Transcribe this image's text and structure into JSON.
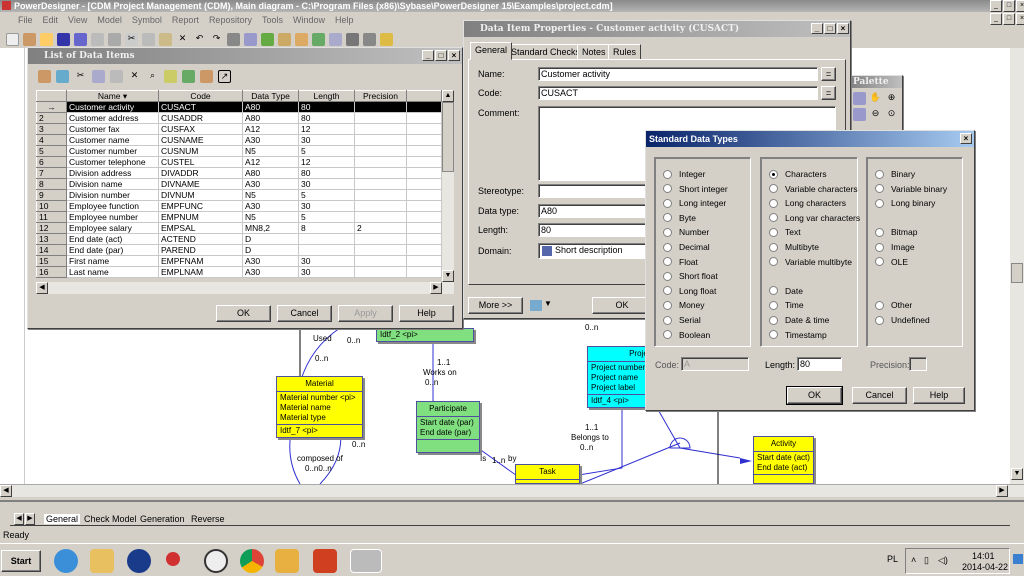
{
  "app": {
    "title": "PowerDesigner - [CDM Project Management (CDM), Main diagram - C:\\Program Files (x86)\\Sybase\\PowerDesigner 15\\Examples\\project.cdm]",
    "menu": [
      "File",
      "Edit",
      "View",
      "Model",
      "Symbol",
      "Report",
      "Repository",
      "Tools",
      "Window",
      "Help"
    ],
    "status": "Ready"
  },
  "list_window": {
    "title": "List of Data Items",
    "columns": [
      "Name",
      "Code",
      "Data Type",
      "Length",
      "Precision"
    ],
    "rows": [
      [
        "→",
        "Customer activity",
        "CUSACT",
        "A80",
        "80",
        ""
      ],
      [
        "2",
        "Customer address",
        "CUSADDR",
        "A80",
        "80",
        ""
      ],
      [
        "3",
        "Customer fax",
        "CUSFAX",
        "A12",
        "12",
        ""
      ],
      [
        "4",
        "Customer name",
        "CUSNAME",
        "A30",
        "30",
        ""
      ],
      [
        "5",
        "Customer number",
        "CUSNUM",
        "N5",
        "5",
        ""
      ],
      [
        "6",
        "Customer telephone",
        "CUSTEL",
        "A12",
        "12",
        ""
      ],
      [
        "7",
        "Division address",
        "DIVADDR",
        "A80",
        "80",
        ""
      ],
      [
        "8",
        "Division name",
        "DIVNAME",
        "A30",
        "30",
        ""
      ],
      [
        "9",
        "Division number",
        "DIVNUM",
        "N5",
        "5",
        ""
      ],
      [
        "10",
        "Employee function",
        "EMPFUNC",
        "A30",
        "30",
        ""
      ],
      [
        "11",
        "Employee number",
        "EMPNUM",
        "N5",
        "5",
        ""
      ],
      [
        "12",
        "Employee salary",
        "EMPSAL",
        "MN8,2",
        "8",
        "2"
      ],
      [
        "13",
        "End date (act)",
        "ACTEND",
        "D",
        "",
        ""
      ],
      [
        "14",
        "End date (par)",
        "PAREND",
        "D",
        "",
        ""
      ],
      [
        "15",
        "First name",
        "EMPFNAM",
        "A30",
        "30",
        ""
      ],
      [
        "16",
        "Last name",
        "EMPLNAM",
        "A30",
        "30",
        ""
      ]
    ],
    "buttons": {
      "ok": "OK",
      "cancel": "Cancel",
      "apply": "Apply",
      "help": "Help"
    }
  },
  "props_window": {
    "title": "Data Item Properties - Customer activity (CUSACT)",
    "tabs": [
      "General",
      "Standard Checks",
      "Notes",
      "Rules"
    ],
    "labels": {
      "name": "Name:",
      "code": "Code:",
      "comment": "Comment:",
      "stereotype": "Stereotype:",
      "datatype": "Data type:",
      "length": "Length:",
      "domain": "Domain:"
    },
    "values": {
      "name": "Customer activity",
      "code": "CUSACT",
      "comment": "",
      "stereotype": "",
      "datatype": "A80",
      "length": "80",
      "domain": "Short description"
    },
    "eq": "=",
    "more": "More >>",
    "ok": "OK"
  },
  "std_types": {
    "title": "Standard Data Types",
    "col1": [
      "Integer",
      "Short integer",
      "Long integer",
      "Byte",
      "Number",
      "Decimal",
      "Float",
      "Short float",
      "Long float",
      "Money",
      "Serial",
      "Boolean"
    ],
    "col2": [
      "Characters",
      "Variable characters",
      "Long characters",
      "Long var characters",
      "Text",
      "Multibyte",
      "Variable multibyte",
      "Date",
      "Time",
      "Date & time",
      "Timestamp"
    ],
    "col3": [
      "Binary",
      "Variable binary",
      "Long binary",
      "Bitmap",
      "Image",
      "OLE",
      "Other",
      "Undefined"
    ],
    "selected": "Characters",
    "code_label": "Code:",
    "code_value": "A",
    "length_label": "Length:",
    "length_value": "80",
    "precision_label": "Precision:",
    "precision_value": "",
    "ok": "OK",
    "cancel": "Cancel",
    "help": "Help"
  },
  "palette": {
    "title": "Palette"
  },
  "diagram": {
    "material": {
      "name": "Material",
      "attrs": [
        "Material number  <pi>",
        "Material name",
        "Material type"
      ],
      "id": "Idtf_7   <pi>"
    },
    "participate": {
      "name": "Participate",
      "attrs": [
        "Start date (par)",
        "End date (par)"
      ]
    },
    "project": {
      "name": "Project",
      "attrs": [
        "Project number",
        "Project name",
        "Project label"
      ],
      "id": "Idtf_4   <pi>"
    },
    "activity": {
      "name": "Activity",
      "attrs": [
        "Start date (act)",
        "End date (act)"
      ]
    },
    "task": {
      "name": "Task"
    },
    "green_id": "Idtf_2   <pi>",
    "labels": [
      "Used",
      "0..n",
      "0..n",
      "1..1",
      "Works on",
      "0..n",
      "0..n",
      "1..1",
      "Belongs to",
      "0..n",
      "composed of",
      "0..n0..n",
      "Is",
      "1..n",
      "by",
      "0..n"
    ]
  },
  "bottom_tabs": [
    "General",
    "Check Model",
    "Generation",
    "Reverse"
  ],
  "taskbar": {
    "start": "Start",
    "lang": "PL",
    "time": "14:01",
    "date": "2014-04-22"
  },
  "colors": {
    "entity_yellow": "#ffff00",
    "entity_green": "#80e080",
    "entity_cyan": "#00ffff",
    "link": "#3030d0"
  }
}
